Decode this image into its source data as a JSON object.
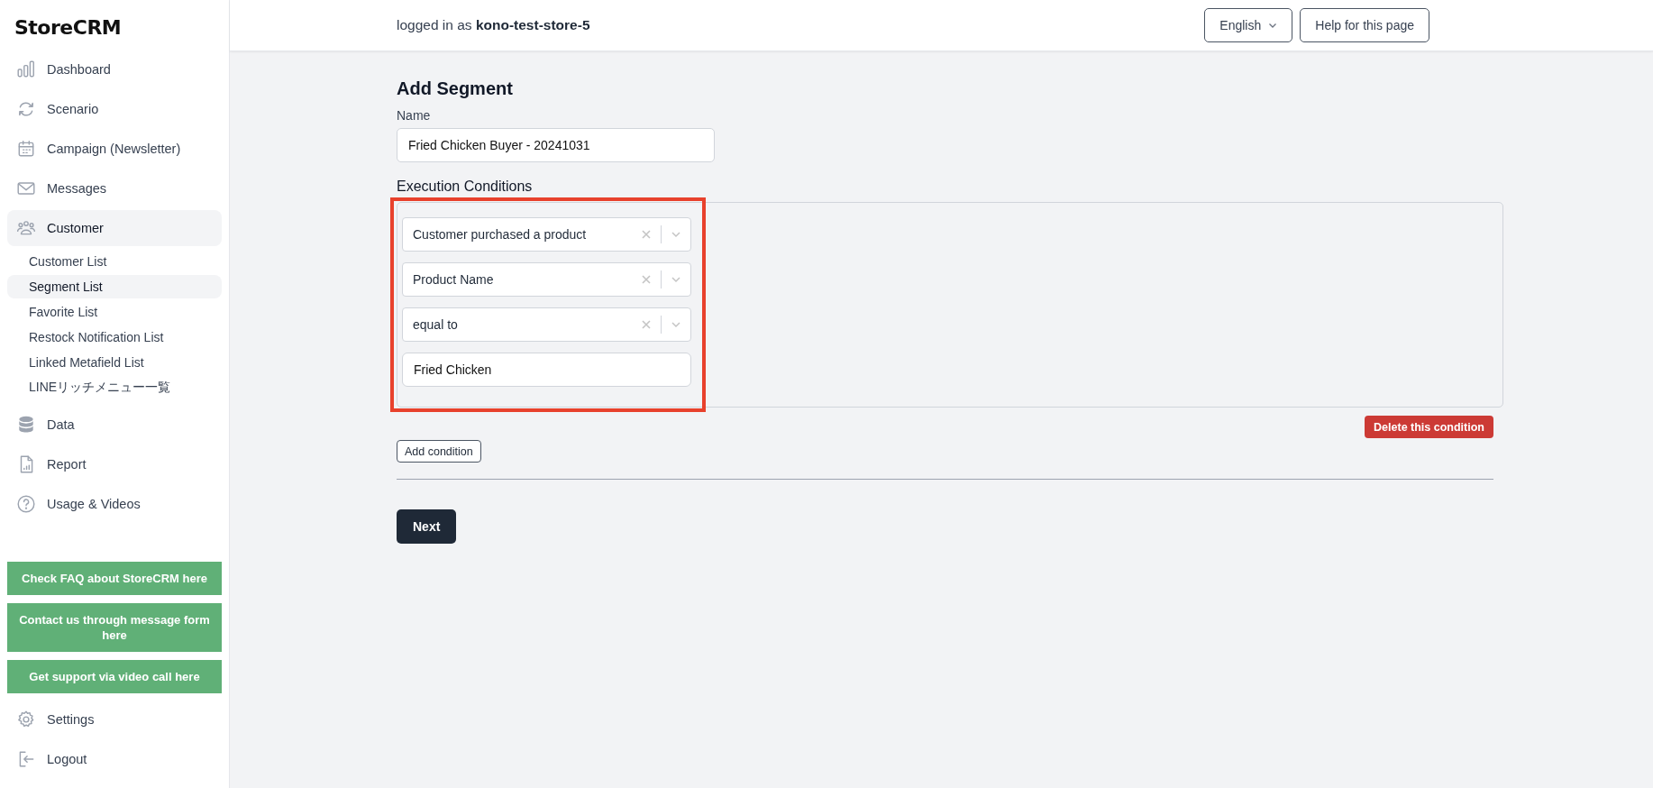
{
  "sidebar": {
    "logo": "StoreCRM",
    "nav": [
      {
        "label": "Dashboard",
        "selected": false
      },
      {
        "label": "Scenario",
        "selected": false
      },
      {
        "label": "Campaign (Newsletter)",
        "selected": false
      },
      {
        "label": "Messages",
        "selected": false
      },
      {
        "label": "Customer",
        "selected": true,
        "children": [
          {
            "label": "Customer List",
            "selected": false
          },
          {
            "label": "Segment List",
            "selected": true
          },
          {
            "label": "Favorite List",
            "selected": false
          },
          {
            "label": "Restock Notification List",
            "selected": false
          },
          {
            "label": "Linked Metafield List",
            "selected": false
          },
          {
            "label": "LINEリッチメニュー一覧",
            "selected": false
          }
        ]
      },
      {
        "label": "Data",
        "selected": false
      },
      {
        "label": "Report",
        "selected": false
      },
      {
        "label": "Usage & Videos",
        "selected": false
      }
    ],
    "support_buttons": [
      "Check FAQ about StoreCRM here",
      "Contact us through message form here",
      "Get support via video call here"
    ],
    "bottom_nav": [
      {
        "label": "Settings",
        "selected": false
      },
      {
        "label": "Logout",
        "selected": false
      }
    ]
  },
  "header": {
    "user": "logged in as **kono-test-store-5**",
    "language": "English",
    "help_button": "Help for this page"
  },
  "form": {
    "title": "Add Segment",
    "name_label": "Name",
    "name_value": "Fried Chicken Buyer - 20241031",
    "conditions_label": "Execution Conditions",
    "conditions": [
      {
        "kind": "select",
        "value": "Customer purchased a product"
      },
      {
        "kind": "select",
        "value": "Product Name"
      },
      {
        "kind": "select",
        "value": "equal to"
      },
      {
        "kind": "text",
        "value": "Fried Chicken"
      }
    ],
    "highlighted": true,
    "delete_button": "Delete this condition",
    "add_button": "Add condition",
    "next_button": "Next"
  }
}
